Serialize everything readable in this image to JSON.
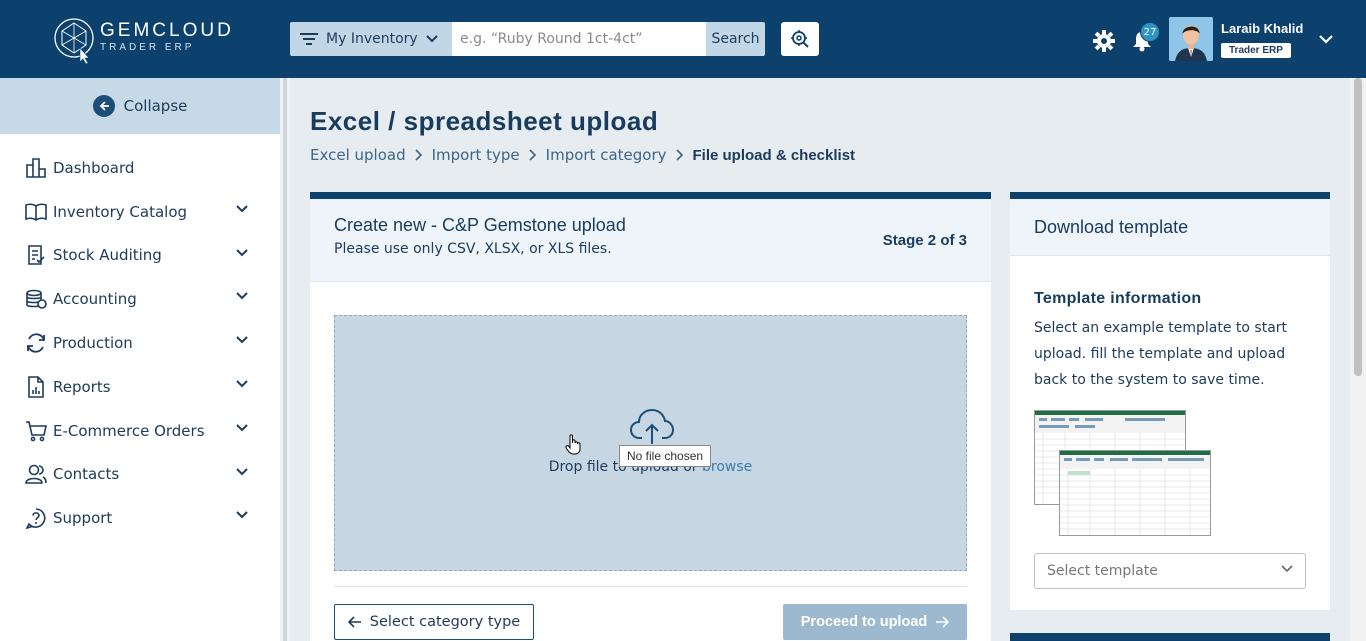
{
  "brand": {
    "name": "GEMCLOUD",
    "tagline": "TRADER ERP"
  },
  "header": {
    "filter_label": "My Inventory",
    "search_placeholder": "e.g. “Ruby Round 1ct-4ct”",
    "search_button": "Search",
    "notification_count": "27",
    "user_name": "Laraib Khalid",
    "user_role": "Trader ERP"
  },
  "sidebar": {
    "collapse_label": "Collapse",
    "items": [
      {
        "label": "Dashboard",
        "icon": "dashboard-icon",
        "has_children": false
      },
      {
        "label": "Inventory Catalog",
        "icon": "book-icon",
        "has_children": true
      },
      {
        "label": "Stock Auditing",
        "icon": "audit-icon",
        "has_children": true
      },
      {
        "label": "Accounting",
        "icon": "coins-icon",
        "has_children": true
      },
      {
        "label": "Production",
        "icon": "refresh-icon",
        "has_children": true
      },
      {
        "label": "Reports",
        "icon": "report-icon",
        "has_children": true
      },
      {
        "label": "E-Commerce Orders",
        "icon": "cart-icon",
        "has_children": true
      },
      {
        "label": "Contacts",
        "icon": "users-icon",
        "has_children": true
      },
      {
        "label": "Support",
        "icon": "help-icon",
        "has_children": true
      }
    ]
  },
  "main": {
    "title": "Excel / spreadsheet upload",
    "breadcrumb": [
      "Excel upload",
      "Import type",
      "Import category",
      "File upload & checklist"
    ],
    "upload_card": {
      "title": "Create new - C&P Gemstone upload",
      "subtitle": "Please use only CSV, XLSX, or XLS files.",
      "stage": "Stage 2 of 3",
      "drop_text": "Drop file to upload or ",
      "browse_text": "browse",
      "tooltip": "No file chosen",
      "back_button": "Select category type",
      "next_button": "Proceed to upload"
    },
    "template_card": {
      "title": "Download template",
      "info_title": "Template information",
      "info_text": "Select an example template to start upload. fill the template and upload back to the system to save time.",
      "select_placeholder": "Select template"
    }
  },
  "colors": {
    "primary": "#0c416e",
    "accent": "#2f95c4",
    "light": "#c6d9e6"
  }
}
